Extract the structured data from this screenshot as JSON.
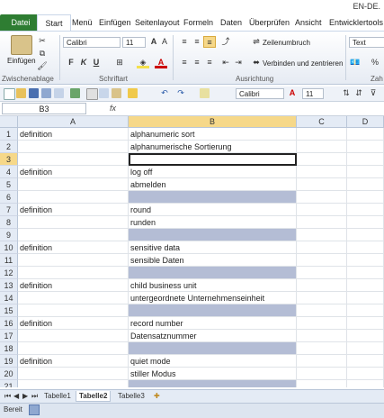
{
  "window": {
    "title": "EN-DE."
  },
  "ribbon": {
    "tabs": [
      "Datei",
      "Start",
      "Menü",
      "Einfügen",
      "Seitenlayout",
      "Formeln",
      "Daten",
      "Überprüfen",
      "Ansicht",
      "Entwicklertools"
    ],
    "paste_label": "Einfügen",
    "font_name": "Calibri",
    "font_size": "11",
    "bold": "F",
    "italic": "K",
    "underline": "U",
    "wrap_text": "Zeilenumbruch",
    "merge_center": "Verbinden und zentrieren",
    "number_format": "Text",
    "percent": "%",
    "groups": {
      "clipboard": "Zwischenablage",
      "font": "Schriftart",
      "alignment": "Ausrichtung",
      "number": "Zah"
    }
  },
  "qat": {
    "font_name": "Calibri",
    "font_size": "11"
  },
  "formula_bar": {
    "name_box": "B3",
    "fx": "fx",
    "value": ""
  },
  "sheet": {
    "columns": [
      "A",
      "B",
      "C",
      "D"
    ],
    "selected_cell": "B3",
    "rows": [
      {
        "num": "1",
        "a": "definition",
        "b": "alphanumeric sort",
        "fill": false
      },
      {
        "num": "2",
        "a": "",
        "b": "alphanumerische Sortierung",
        "fill": false
      },
      {
        "num": "3",
        "a": "",
        "b": "",
        "fill": false,
        "active": true
      },
      {
        "num": "4",
        "a": "definition",
        "b": "log off",
        "fill": false
      },
      {
        "num": "5",
        "a": "",
        "b": "abmelden",
        "fill": false
      },
      {
        "num": "6",
        "a": "",
        "b": "",
        "fill": true
      },
      {
        "num": "7",
        "a": "definition",
        "b": "round",
        "fill": false
      },
      {
        "num": "8",
        "a": "",
        "b": "runden",
        "fill": false
      },
      {
        "num": "9",
        "a": "",
        "b": "",
        "fill": true
      },
      {
        "num": "10",
        "a": "definition",
        "b": "sensitive data",
        "fill": false
      },
      {
        "num": "11",
        "a": "",
        "b": "sensible Daten",
        "fill": false
      },
      {
        "num": "12",
        "a": "",
        "b": "",
        "fill": true
      },
      {
        "num": "13",
        "a": "definition",
        "b": "child business unit",
        "fill": false
      },
      {
        "num": "14",
        "a": "",
        "b": "untergeordnete Unternehmenseinheit",
        "fill": false
      },
      {
        "num": "15",
        "a": "",
        "b": "",
        "fill": true
      },
      {
        "num": "16",
        "a": "definition",
        "b": "record number",
        "fill": false
      },
      {
        "num": "17",
        "a": "",
        "b": "Datensatznummer",
        "fill": false
      },
      {
        "num": "18",
        "a": "",
        "b": "",
        "fill": true
      },
      {
        "num": "19",
        "a": "definition",
        "b": "quiet mode",
        "fill": false
      },
      {
        "num": "20",
        "a": "",
        "b": "stiller Modus",
        "fill": false
      },
      {
        "num": "21",
        "a": "",
        "b": "",
        "fill": true
      }
    ],
    "tabs": [
      "Tabelle1",
      "Tabelle2",
      "Tabelle3"
    ],
    "active_tab": "Tabelle2"
  },
  "status": {
    "mode": "Bereit"
  },
  "colors": {
    "band_fill": "#b4bdd5",
    "selected_header": "#f6d889",
    "file_tab": "#2e7d32"
  }
}
